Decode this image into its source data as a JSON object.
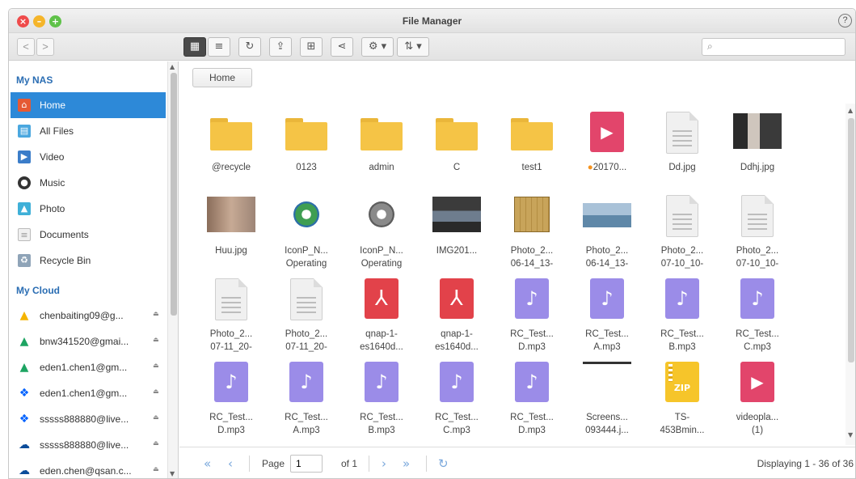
{
  "window": {
    "title": "File Manager",
    "help_label": "?"
  },
  "toolbar": {
    "back_label": "<",
    "forward_label": ">",
    "search_placeholder": ""
  },
  "sidebar": {
    "my_nas_label": "My NAS",
    "nas_items": [
      {
        "label": "Home",
        "icon": "home-icon"
      },
      {
        "label": "All Files",
        "icon": "all-files-icon"
      },
      {
        "label": "Video",
        "icon": "video-icon"
      },
      {
        "label": "Music",
        "icon": "music-icon"
      },
      {
        "label": "Photo",
        "icon": "photo-icon"
      },
      {
        "label": "Documents",
        "icon": "documents-icon"
      },
      {
        "label": "Recycle Bin",
        "icon": "recycle-bin-icon"
      }
    ],
    "my_cloud_label": "My Cloud",
    "cloud_items": [
      {
        "label": "chenbaiting09@g...",
        "icon": "google-drive-icon"
      },
      {
        "label": "bnw341520@gmai...",
        "icon": "google-drive-icon"
      },
      {
        "label": "eden1.chen1@gm...",
        "icon": "google-drive-icon"
      },
      {
        "label": "eden1.chen1@gm...",
        "icon": "dropbox-icon"
      },
      {
        "label": "sssss888880@live...",
        "icon": "dropbox-icon"
      },
      {
        "label": "sssss888880@live...",
        "icon": "onedrive-icon"
      },
      {
        "label": "eden.chen@qsan.c...",
        "icon": "onedrive-icon"
      }
    ]
  },
  "main": {
    "breadcrumb": "Home",
    "files": [
      {
        "name": "@recycle",
        "name2": "",
        "type": "folder"
      },
      {
        "name": "0123",
        "name2": "",
        "type": "folder"
      },
      {
        "name": "admin",
        "name2": "",
        "type": "folder"
      },
      {
        "name": "C",
        "name2": "",
        "type": "folder"
      },
      {
        "name": "test1",
        "name2": "",
        "type": "folder"
      },
      {
        "name": "20170...",
        "name2": "",
        "type": "video",
        "dot": "●"
      },
      {
        "name": "Dd.jpg",
        "name2": "",
        "type": "doc"
      },
      {
        "name": "Ddhj.jpg",
        "name2": "",
        "type": "photo-dark"
      },
      {
        "name": "Huu.jpg",
        "name2": "",
        "type": "photo-blur"
      },
      {
        "name": "IconP_N...",
        "name2": "Operating",
        "type": "app-green"
      },
      {
        "name": "IconP_N...",
        "name2": "Operating",
        "type": "app-gray"
      },
      {
        "name": "IMG201...",
        "name2": "",
        "type": "photo-desk"
      },
      {
        "name": "Photo_2...",
        "name2": "06-14_13-",
        "type": "photo-board"
      },
      {
        "name": "Photo_2...",
        "name2": "06-14_13-",
        "type": "photo-lake"
      },
      {
        "name": "Photo_2...",
        "name2": "07-10_10-",
        "type": "doc"
      },
      {
        "name": "Photo_2...",
        "name2": "07-10_10-",
        "type": "doc"
      },
      {
        "name": "Photo_2...",
        "name2": "07-11_20-",
        "type": "doc"
      },
      {
        "name": "Photo_2...",
        "name2": "07-11_20-",
        "type": "doc"
      },
      {
        "name": "qnap-1-",
        "name2": "es1640d...",
        "type": "pdf"
      },
      {
        "name": "qnap-1-",
        "name2": "es1640d...",
        "type": "pdf"
      },
      {
        "name": "RC_Test...",
        "name2": "D.mp3",
        "type": "audio"
      },
      {
        "name": "RC_Test...",
        "name2": "A.mp3",
        "type": "audio"
      },
      {
        "name": "RC_Test...",
        "name2": "B.mp3",
        "type": "audio"
      },
      {
        "name": "RC_Test...",
        "name2": "C.mp3",
        "type": "audio"
      },
      {
        "name": "RC_Test...",
        "name2": "D.mp3",
        "type": "audio"
      },
      {
        "name": "RC_Test...",
        "name2": "A.mp3",
        "type": "audio"
      },
      {
        "name": "RC_Test...",
        "name2": "B.mp3",
        "type": "audio"
      },
      {
        "name": "RC_Test...",
        "name2": "C.mp3",
        "type": "audio"
      },
      {
        "name": "RC_Test...",
        "name2": "D.mp3",
        "type": "audio"
      },
      {
        "name": "Screens...",
        "name2": "093444.j...",
        "type": "screenshot"
      },
      {
        "name": "TS-",
        "name2": "453Bmin...",
        "type": "zip"
      },
      {
        "name": "videopla...",
        "name2": "(1)",
        "type": "video"
      }
    ]
  },
  "pager": {
    "page_label": "Page",
    "page_value": "1",
    "of_label": "of 1",
    "displaying": "Displaying 1 - 36 of 36"
  },
  "colors": {
    "accent": "#2d89d8",
    "folder": "#f5c446",
    "video": "#e2456b",
    "pdf": "#e2424a",
    "audio": "#9b8ce8"
  }
}
